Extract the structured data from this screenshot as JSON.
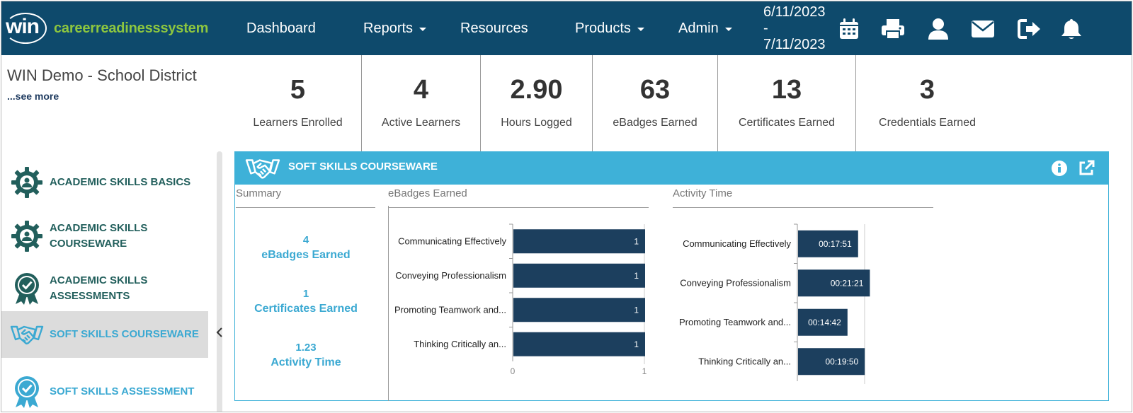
{
  "logo": {
    "brand": "win",
    "product": "careerreadinesssystem"
  },
  "nav": {
    "dashboard": "Dashboard",
    "reports": "Reports",
    "resources": "Resources",
    "products": "Products",
    "admin": "Admin",
    "date_start": "6/11/2023",
    "date_sep": "-",
    "date_end": "7/11/2023"
  },
  "org": {
    "name": "WIN Demo - School District",
    "see_more": "...see more"
  },
  "stats": [
    {
      "value": "5",
      "label": "Learners Enrolled"
    },
    {
      "value": "4",
      "label": "Active Learners"
    },
    {
      "value": "2.90",
      "label": "Hours Logged"
    },
    {
      "value": "63",
      "label": "eBadges Earned"
    },
    {
      "value": "13",
      "label": "Certificates Earned"
    },
    {
      "value": "3",
      "label": "Credentials Earned"
    }
  ],
  "sidebar": {
    "items": [
      {
        "label1": "Academic Skills Basics",
        "label2": ""
      },
      {
        "label1": "Academic Skills",
        "label2": "Courseware"
      },
      {
        "label1": "Academic Skills",
        "label2": "Assessments"
      },
      {
        "label1": "Soft Skills Courseware",
        "label2": ""
      },
      {
        "label1": "Soft Skills Assessment",
        "label2": ""
      }
    ]
  },
  "panel": {
    "title": "SOFT SKILLS COURSEWARE",
    "summary_title": "Summary",
    "ebadges_title": "eBadges Earned",
    "activity_title": "Activity Time",
    "summary": [
      {
        "value": "4",
        "label": "eBadges Earned"
      },
      {
        "value": "1",
        "label": "Certificates Earned"
      },
      {
        "value": "1.23",
        "label": "Activity Time"
      }
    ]
  },
  "chart_data": [
    {
      "type": "bar",
      "orientation": "horizontal",
      "title": "eBadges Earned",
      "categories": [
        "Communicating Effectively",
        "Conveying Professionalism",
        "Promoting Teamwork and...",
        "Thinking Critically an..."
      ],
      "values": [
        1,
        1,
        1,
        1
      ],
      "data_labels": [
        "1",
        "1",
        "1",
        "1"
      ],
      "xlim": [
        0,
        1
      ],
      "x_ticks": [
        "0",
        "1"
      ],
      "color": "#1c3f5e"
    },
    {
      "type": "bar",
      "orientation": "horizontal",
      "title": "Activity Time",
      "categories": [
        "Communicating Effectively",
        "Conveying Professionalism",
        "Promoting Teamwork and...",
        "Thinking Critically an..."
      ],
      "values_seconds": [
        1071,
        1281,
        882,
        1190
      ],
      "data_labels": [
        "00:17:51",
        "00:21:21",
        "00:14:42",
        "00:19:50"
      ],
      "xlim_seconds": [
        0,
        2400
      ],
      "color": "#1c3f5e"
    }
  ],
  "colors": {
    "nav_bg": "#0e4a6c",
    "accent": "#3eb1d8",
    "logo_green": "#8dc63f",
    "bar": "#1c3f5e",
    "side_text": "#225f5c"
  }
}
